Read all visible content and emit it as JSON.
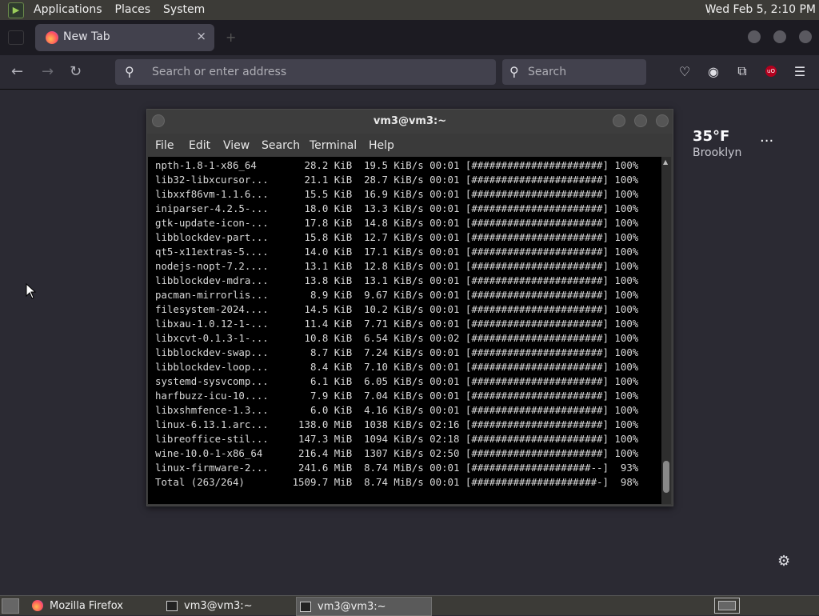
{
  "top_panel": {
    "menus": [
      "Applications",
      "Places",
      "System"
    ],
    "clock": "Wed Feb  5, 2:10 PM"
  },
  "browser": {
    "tab": {
      "title": "New Tab",
      "close": "×"
    },
    "new_tab": "+",
    "urlbar_placeholder": "Search or enter address",
    "searchbar_placeholder": "Search"
  },
  "weather": {
    "temp": "35°F",
    "city": "Brooklyn",
    "more": "···"
  },
  "terminal": {
    "title": "vm3@vm3:~",
    "menus": [
      "File",
      "Edit",
      "View",
      "Search",
      "Terminal",
      "Help"
    ],
    "lines": [
      "npth-1.8-1-x86_64        28.2 KiB  19.5 KiB/s 00:01 [######################] 100%",
      "lib32-libxcursor...      21.1 KiB  28.7 KiB/s 00:01 [######################] 100%",
      "libxxf86vm-1.1.6...      15.5 KiB  16.9 KiB/s 00:01 [######################] 100%",
      "iniparser-4.2.5-...      18.0 KiB  13.3 KiB/s 00:01 [######################] 100%",
      "gtk-update-icon-...      17.8 KiB  14.8 KiB/s 00:01 [######################] 100%",
      "libblockdev-part...      15.8 KiB  12.7 KiB/s 00:01 [######################] 100%",
      "qt5-x11extras-5....      14.0 KiB  17.1 KiB/s 00:01 [######################] 100%",
      "nodejs-nopt-7.2....      13.1 KiB  12.8 KiB/s 00:01 [######################] 100%",
      "libblockdev-mdra...      13.8 KiB  13.1 KiB/s 00:01 [######################] 100%",
      "pacman-mirrorlis...       8.9 KiB  9.67 KiB/s 00:01 [######################] 100%",
      "filesystem-2024....      14.5 KiB  10.2 KiB/s 00:01 [######################] 100%",
      "libxau-1.0.12-1-...      11.4 KiB  7.71 KiB/s 00:01 [######################] 100%",
      "libxcvt-0.1.3-1-...      10.8 KiB  6.54 KiB/s 00:02 [######################] 100%",
      "libblockdev-swap...       8.7 KiB  7.24 KiB/s 00:01 [######################] 100%",
      "libblockdev-loop...       8.4 KiB  7.10 KiB/s 00:01 [######################] 100%",
      "systemd-sysvcomp...       6.1 KiB  6.05 KiB/s 00:01 [######################] 100%",
      "harfbuzz-icu-10....       7.9 KiB  7.04 KiB/s 00:01 [######################] 100%",
      "libxshmfence-1.3...       6.0 KiB  4.16 KiB/s 00:01 [######################] 100%",
      "linux-6.13.1.arc...     138.0 MiB  1038 KiB/s 02:16 [######################] 100%",
      "libreoffice-stil...     147.3 MiB  1094 KiB/s 02:18 [######################] 100%",
      "wine-10.0-1-x86_64      216.4 MiB  1307 KiB/s 02:50 [######################] 100%",
      "linux-firmware-2...     241.6 MiB  8.74 MiB/s 00:01 [####################--]  93%",
      "Total (263/264)        1509.7 MiB  8.74 MiB/s 00:01 [#####################-]  98%"
    ]
  },
  "taskbar": {
    "items": [
      {
        "label": "Mozilla Firefox"
      },
      {
        "label": "vm3@vm3:~"
      },
      {
        "label": "vm3@vm3:~"
      }
    ]
  }
}
